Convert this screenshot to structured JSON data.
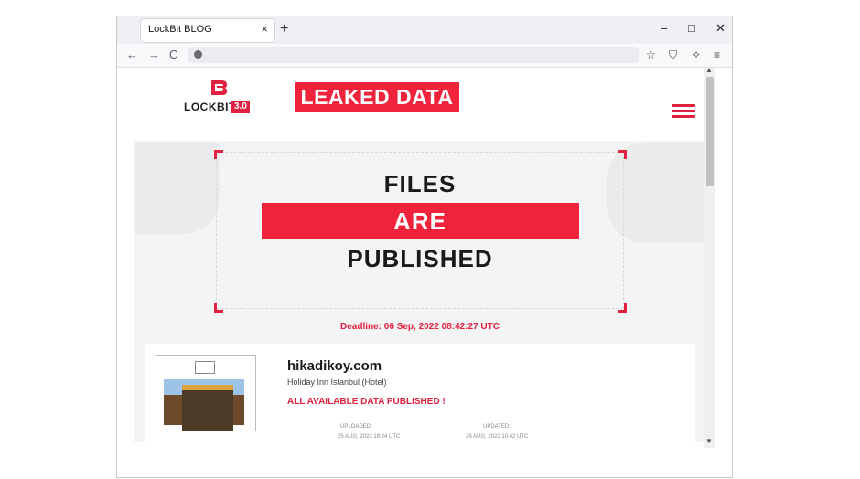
{
  "browser": {
    "tab_title": "LockBit BLOG",
    "tab_close_icon": "close-icon",
    "new_tab_label": "+",
    "window_controls": {
      "minimize": "–",
      "maximize": "□",
      "close": "✕"
    },
    "nav": {
      "back": "←",
      "forward": "→",
      "reload": "C"
    },
    "url": ""
  },
  "site": {
    "logo_text_main": "LOCKBIT",
    "logo_text_version": "3.0",
    "badge": "LEAKED DATA",
    "hero": {
      "line1": "FILES",
      "line2": "ARE",
      "line3": "PUBLISHED"
    },
    "deadline": "Deadline: 06 Sep, 2022 08:42:27 UTC",
    "colors": {
      "accent": "#f0233d",
      "text": "#1a1a1a",
      "bg": "#f4f4f4"
    }
  },
  "post": {
    "title": "hikadikoy.com",
    "subtitle": "Holiday Inn Istanbul (Hotel)",
    "status": "ALL AVAILABLE DATA PUBLISHED !",
    "uploaded_label": "UPLOADED:",
    "uploaded_value": "25 AUG, 2022 18:24 UTC",
    "updated_label": "UPDATED:",
    "updated_value": "26 AUG, 2022 10:42 UTC"
  }
}
